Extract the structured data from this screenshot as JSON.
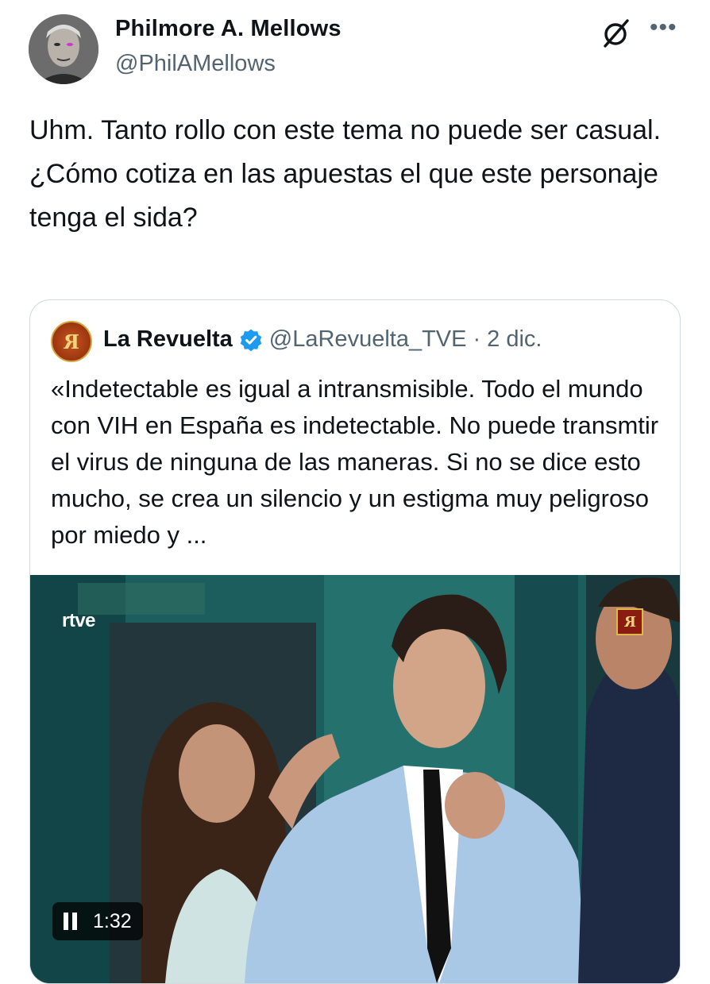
{
  "author": {
    "display_name": "Philmore A. Mellows",
    "handle": "@PhilAMellows"
  },
  "icons": {
    "avatar": "profile-photo",
    "grok": "grok-icon",
    "more": "more-options-icon",
    "verified": "verified-badge-icon",
    "pause": "pause-icon"
  },
  "tweet": {
    "lines": [
      "Uhm. Tanto rollo con este tema no puede ser casual.",
      "¿Cómo cotiza en las apuestas el que este personaje tenga el sida?"
    ]
  },
  "quote": {
    "display_name": "La Revuelta",
    "handle": "@LaRevuelta_TVE",
    "separator": "·",
    "date": "2 dic.",
    "text": "«Indetectable es igual a intransmisible. Todo el mundo con VIH en España es indetectable. No puede transmtir el virus de ninguna de las maneras. Si no se dice esto mucho, se crea un silencio y un estigma muy peligroso por miedo y ...",
    "video": {
      "channel_logo": "rtve",
      "elapsed": "1:32"
    }
  },
  "colors": {
    "text_primary": "#0f1419",
    "text_secondary": "#536471",
    "border": "#cfd9de",
    "verified": "#1d9bf0"
  }
}
